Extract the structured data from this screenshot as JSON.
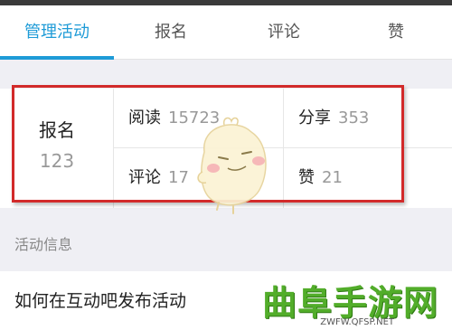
{
  "tabs": [
    {
      "label": "管理活动",
      "active": true
    },
    {
      "label": "报名",
      "active": false
    },
    {
      "label": "评论",
      "active": false
    },
    {
      "label": "赞",
      "active": false
    }
  ],
  "stats": {
    "signup": {
      "label": "报名",
      "value": "123"
    },
    "read": {
      "label": "阅读",
      "value": "15723"
    },
    "share": {
      "label": "分享",
      "value": "353"
    },
    "comment": {
      "label": "评论",
      "value": "17"
    },
    "like": {
      "label": "赞",
      "value": "21"
    }
  },
  "section": {
    "title": "活动信息"
  },
  "activity": {
    "title": "如何在互动吧发布活动"
  },
  "watermark": {
    "brand": "曲阜手游网",
    "url": "ZWFW.QFSP.NET"
  },
  "colors": {
    "accent": "#1e9bd7",
    "highlight": "#d22a2a",
    "watermark": "#52ad2a"
  }
}
